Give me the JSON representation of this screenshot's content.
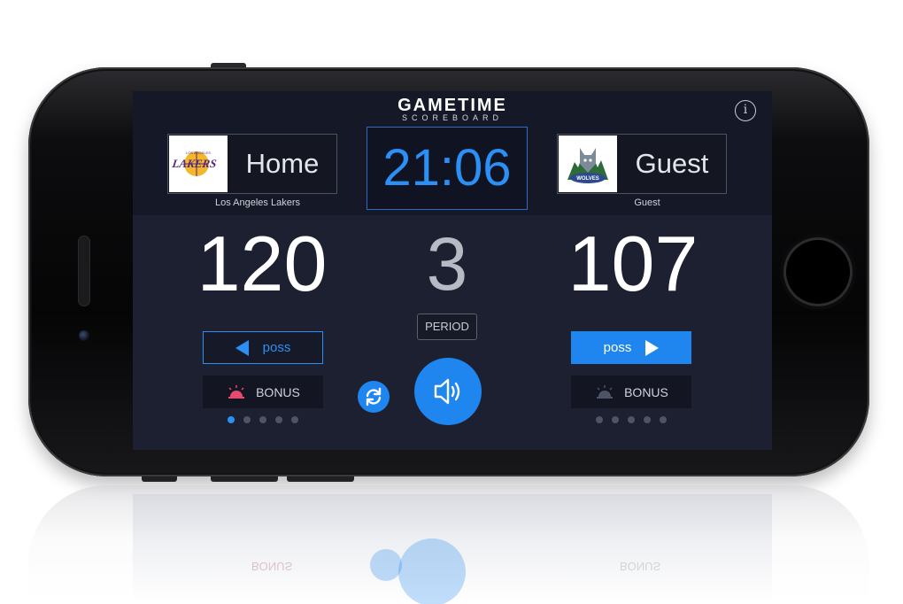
{
  "app": {
    "logo_main": "GAMETIME",
    "logo_sub": "SCOREBOARD",
    "info_icon": "i"
  },
  "home": {
    "name": "Home",
    "team_label": "Los Angeles Lakers",
    "score": "120",
    "poss_label": "poss",
    "bonus_label": "BONUS",
    "bonus_active": true,
    "page_dots": 5,
    "active_dot": 0,
    "logo_icon": "lakers-logo"
  },
  "guest": {
    "name": "Guest",
    "team_label": "Guest",
    "score": "107",
    "poss_label": "poss",
    "bonus_label": "BONUS",
    "bonus_active": false,
    "page_dots": 5,
    "active_dot": -1,
    "logo_icon": "timberwolves-logo"
  },
  "clock": {
    "time": "21:06"
  },
  "period": {
    "value": "3",
    "label": "PERIOD"
  },
  "controls": {
    "swap_icon": "swap-icon",
    "horn_icon": "speaker-icon"
  },
  "reflection": {
    "bonus_label": "BONUS"
  },
  "colors": {
    "accent": "#1e86ee",
    "clock_text": "#2b8ff5",
    "bonus_active": "#e8496e",
    "bonus_inactive": "#4d5466",
    "screen_bg": "#1d2030"
  }
}
